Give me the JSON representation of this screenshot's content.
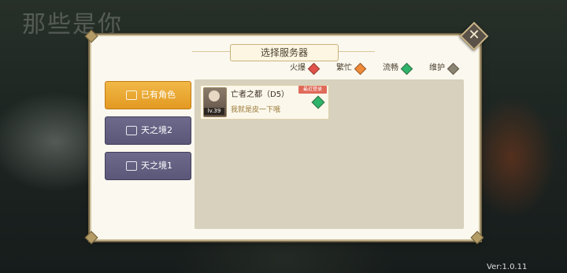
{
  "background": {
    "logo_text": "那些是你"
  },
  "dialog": {
    "title": "选择服务器",
    "close_icon": "close-x-icon"
  },
  "legend": [
    {
      "label": "火爆",
      "color": "#e0524b"
    },
    {
      "label": "繁忙",
      "color": "#ee8a3a"
    },
    {
      "label": "流畅",
      "color": "#2db36a"
    },
    {
      "label": "维护",
      "color": "#8a8474"
    }
  ],
  "tabs": [
    {
      "label": "已有角色",
      "active": true,
      "icon": "server-icon"
    },
    {
      "label": "天之境2",
      "active": false,
      "icon": "server-icon"
    },
    {
      "label": "天之境1",
      "active": false,
      "icon": "server-icon"
    }
  ],
  "server_list": [
    {
      "server_name": "亡者之都（D5）",
      "character_name": "我就是皮一下哦",
      "level": "lv.39",
      "badge": "最近登录",
      "status_color": "#2db36a"
    }
  ],
  "footer": {
    "version": "Ver:1.0.11"
  }
}
